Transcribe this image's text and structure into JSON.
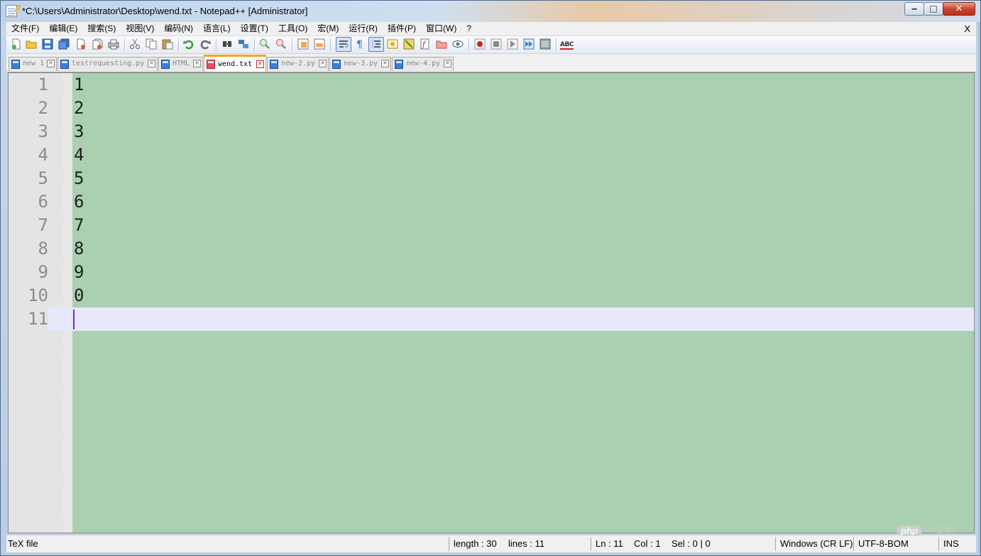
{
  "window": {
    "title": "*C:\\Users\\Administrator\\Desktop\\wend.txt - Notepad++ [Administrator]",
    "controls": {
      "minimize": "‒",
      "maximize": "□",
      "close": "✕"
    }
  },
  "menu": {
    "items": [
      "文件(F)",
      "编辑(E)",
      "搜索(S)",
      "视图(V)",
      "编码(N)",
      "语言(L)",
      "设置(T)",
      "工具(O)",
      "宏(M)",
      "运行(R)",
      "插件(P)",
      "窗口(W)",
      "?"
    ],
    "close_label": "X"
  },
  "toolbar": {
    "icons": [
      "new-file-icon",
      "open-file-icon",
      "save-icon",
      "save-all-icon",
      "close-icon",
      "close-all-icon",
      "print-icon",
      "cut-icon",
      "copy-icon",
      "paste-icon",
      "undo-icon",
      "redo-icon",
      "find-icon",
      "replace-icon",
      "zoom-in-icon",
      "zoom-out-icon",
      "sync-vertical-icon",
      "sync-horizontal-icon",
      "word-wrap-icon",
      "show-all-chars-icon",
      "indent-guide-icon",
      "user-language-icon",
      "doc-map-icon",
      "function-list-icon",
      "folder-workspace-icon",
      "monitoring-icon",
      "record-macro-icon",
      "stop-record-icon",
      "play-macro-icon",
      "run-macro-multiple-icon",
      "save-macro-icon",
      "spell-check-icon"
    ],
    "spell_check_label": "ABC"
  },
  "tabs": [
    {
      "label": "new 1",
      "active": false
    },
    {
      "label": "testrequesting.py",
      "active": false
    },
    {
      "label": "HTML",
      "active": false
    },
    {
      "label": "wend.txt",
      "active": true
    },
    {
      "label": "new-2.py",
      "active": false
    },
    {
      "label": "new-3.py",
      "active": false
    },
    {
      "label": "new-4.py",
      "active": false
    }
  ],
  "editor": {
    "lines": [
      {
        "num": "1",
        "text": "1"
      },
      {
        "num": "2",
        "text": "2"
      },
      {
        "num": "3",
        "text": "3"
      },
      {
        "num": "4",
        "text": "4"
      },
      {
        "num": "5",
        "text": "5"
      },
      {
        "num": "6",
        "text": "6"
      },
      {
        "num": "7",
        "text": "7"
      },
      {
        "num": "8",
        "text": "8"
      },
      {
        "num": "9",
        "text": "9"
      },
      {
        "num": "10",
        "text": "0"
      },
      {
        "num": "11",
        "text": ""
      }
    ],
    "current_line": 11,
    "background": "#aad0b1",
    "current_line_bg": "#e7e8fa"
  },
  "status": {
    "file_type": "TeX file",
    "length": "length : 30",
    "lines": "lines : 11",
    "ln": "Ln : 11",
    "col": "Col : 1",
    "sel": "Sel : 0 | 0",
    "eol": "Windows (CR LF)",
    "encoding": "UTF-8-BOM",
    "mode": "INS"
  },
  "watermark": {
    "logo": "php",
    "text": "中文网"
  }
}
